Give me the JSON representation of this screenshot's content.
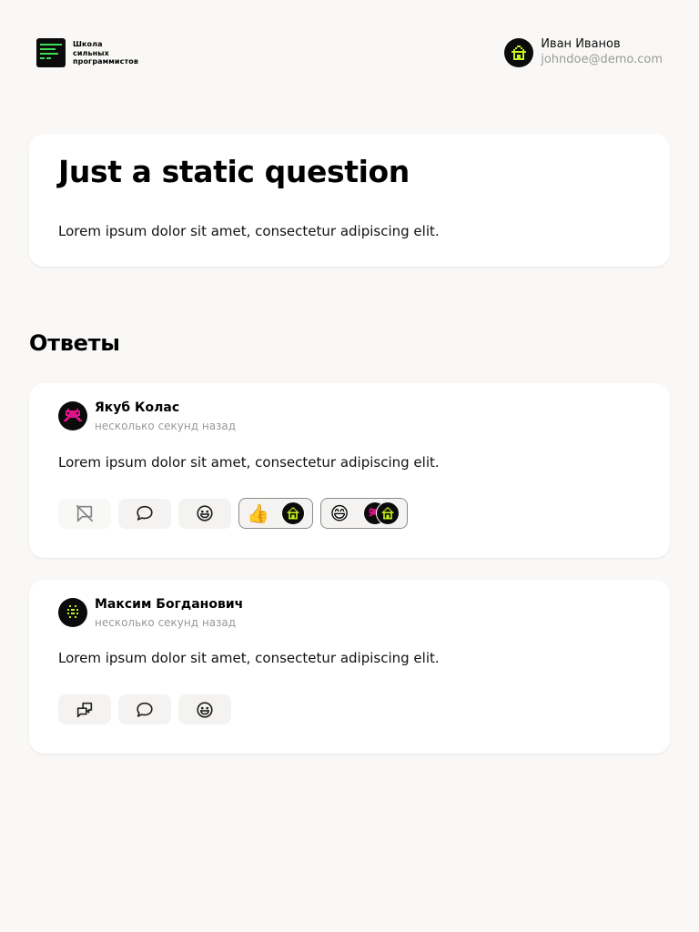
{
  "header": {
    "logo_lines": [
      "Школа",
      "сильных",
      "программистов"
    ],
    "user": {
      "name": "Иван Иванов",
      "email": "johndoe@demo.com"
    }
  },
  "question": {
    "title": "Just a static question",
    "body": "Lorem ipsum dolor sit amet, consectetur adipiscing elit."
  },
  "answers_section": {
    "title": "Ответы",
    "answers": [
      {
        "author": "Якуб Колас",
        "time": "несколько секунд назад",
        "body": "Lorem ipsum dolor sit amet, consectetur adipiscing elit.",
        "reactions": [
          {
            "emoji": "👍"
          },
          {
            "emoji": "😄"
          }
        ]
      },
      {
        "author": "Максим Богданович",
        "time": "несколько секунд назад",
        "body": "Lorem ipsum dolor sit amet, consectetur adipiscing elit."
      }
    ]
  },
  "colors": {
    "background": "#f9f8f6",
    "card": "#ffffff",
    "accent_green": "#3ddc56",
    "avatar_lime": "#c6f21f",
    "avatar_magenta": "#e0148a",
    "muted_text": "#9a9a9a"
  },
  "icons": {
    "logo": "terminal-lines-icon",
    "mark_answer_disabled": "chat-off-icon",
    "mark_answer": "chat-flag-icon",
    "comment": "speech-bubble-icon",
    "add_reaction": "smiley-icon"
  }
}
